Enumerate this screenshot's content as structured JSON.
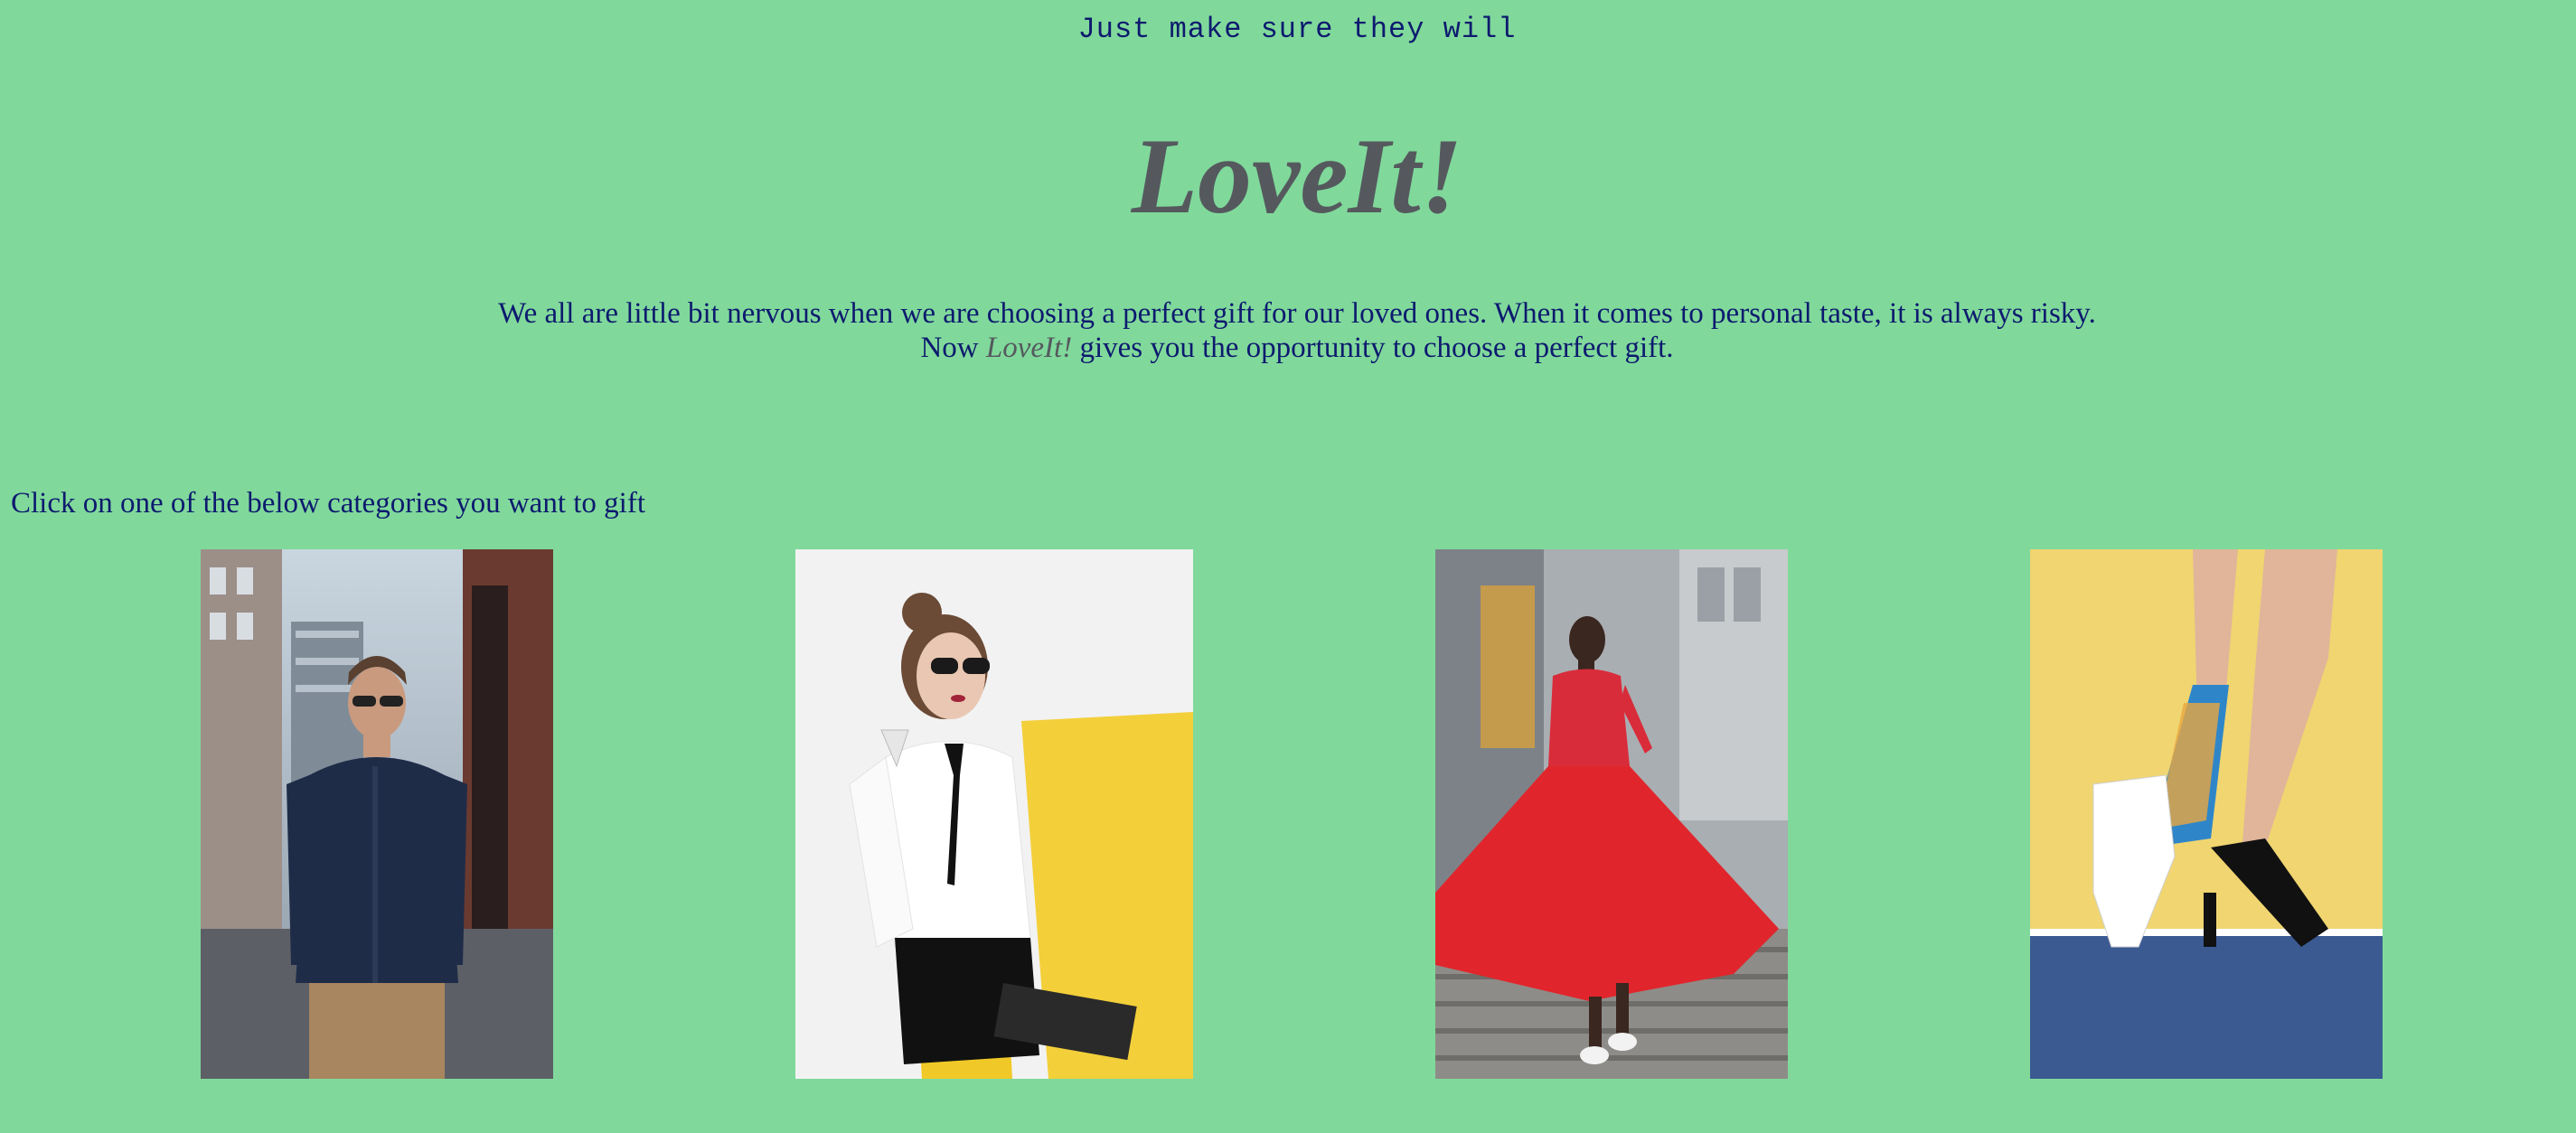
{
  "header": {
    "tagline": "Just make sure they will",
    "title": "LoveIt!"
  },
  "intro": {
    "line1": "We all are little bit nervous when we are choosing a perfect gift for our loved ones. When it comes to personal taste, it is always risky.",
    "line2_before": "Now ",
    "line2_brand": "LoveIt!",
    "line2_after": " gives you the opportunity to choose a perfect gift."
  },
  "categories": {
    "prompt": "Click on one of the below categories you want to gift",
    "items": [
      {
        "image": "man-in-shirt-and-sunglasses-photo"
      },
      {
        "image": "woman-in-white-blouse-on-yellow-chair-photo"
      },
      {
        "image": "woman-in-red-dress-on-stairs-photo"
      },
      {
        "image": "legs-with-patterned-socks-and-heels-photo"
      }
    ]
  },
  "colors": {
    "background": "#80d99b",
    "text": "#0d1a6e",
    "brand": "#55595e"
  }
}
